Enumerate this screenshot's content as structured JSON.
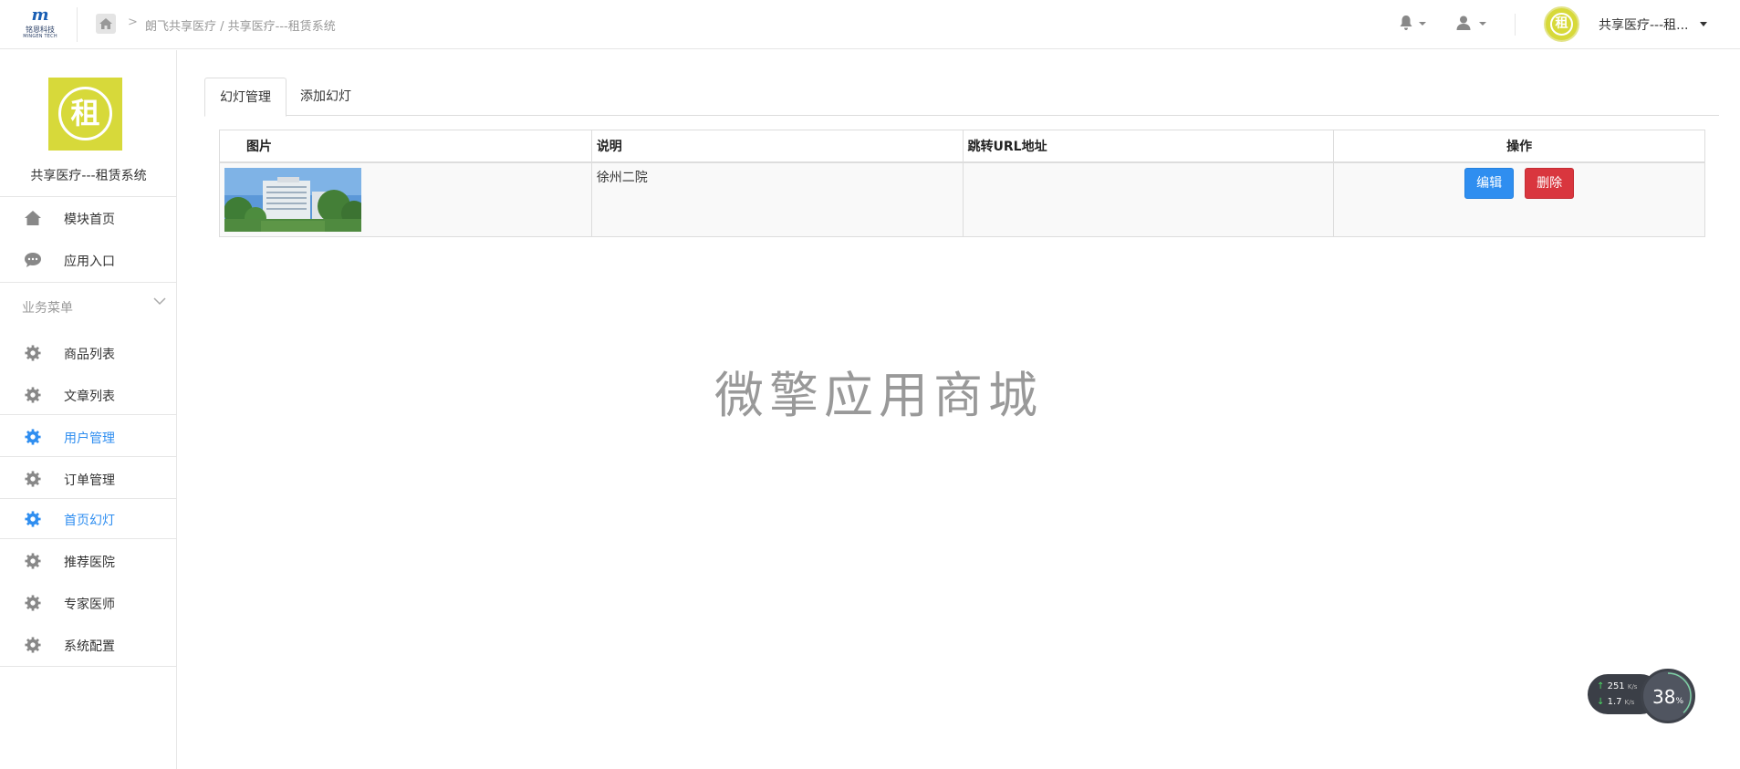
{
  "header": {
    "logo_text": "铭恩科技",
    "logo_sub": "MINGEN TECH",
    "breadcrumb": "朗飞共享医疗 / 共享医疗---租赁系统",
    "avatar_char": "租",
    "account_name": "共享医疗---租..."
  },
  "sidebar": {
    "logo_char": "租",
    "title": "共享医疗---租赁系统",
    "top_items": [
      {
        "label": "模块首页",
        "icon": "home-icon"
      },
      {
        "label": "应用入口",
        "icon": "chat-icon"
      }
    ],
    "section_label": "业务菜单",
    "items": [
      {
        "label": "商品列表",
        "icon": "gear-icon"
      },
      {
        "label": "文章列表",
        "icon": "gear-icon"
      },
      {
        "label": "用户管理",
        "icon": "gear-icon"
      },
      {
        "label": "订单管理",
        "icon": "gear-icon"
      },
      {
        "label": "首页幻灯",
        "icon": "gear-icon"
      },
      {
        "label": "推荐医院",
        "icon": "gear-icon"
      },
      {
        "label": "专家医师",
        "icon": "gear-icon"
      },
      {
        "label": "系统配置",
        "icon": "gear-icon"
      }
    ]
  },
  "tabs": [
    {
      "label": "幻灯管理",
      "active": true
    },
    {
      "label": "添加幻灯",
      "active": false
    }
  ],
  "table": {
    "columns": [
      "图片",
      "说明",
      "跳转URL地址",
      "操作"
    ],
    "rows": [
      {
        "image": "hospital-photo",
        "description": "徐州二院",
        "url": "",
        "edit_label": "编辑",
        "delete_label": "删除"
      }
    ]
  },
  "watermark": "微擎应用商城",
  "network": {
    "up": "251",
    "up_unit": "K/s",
    "down": "1.7",
    "down_unit": "K/s",
    "cpu": "38",
    "cpu_unit": "%"
  },
  "colors": {
    "accent": "#2f8ef0",
    "danger": "#d9363e",
    "brand_yellow": "#d7d93a"
  }
}
